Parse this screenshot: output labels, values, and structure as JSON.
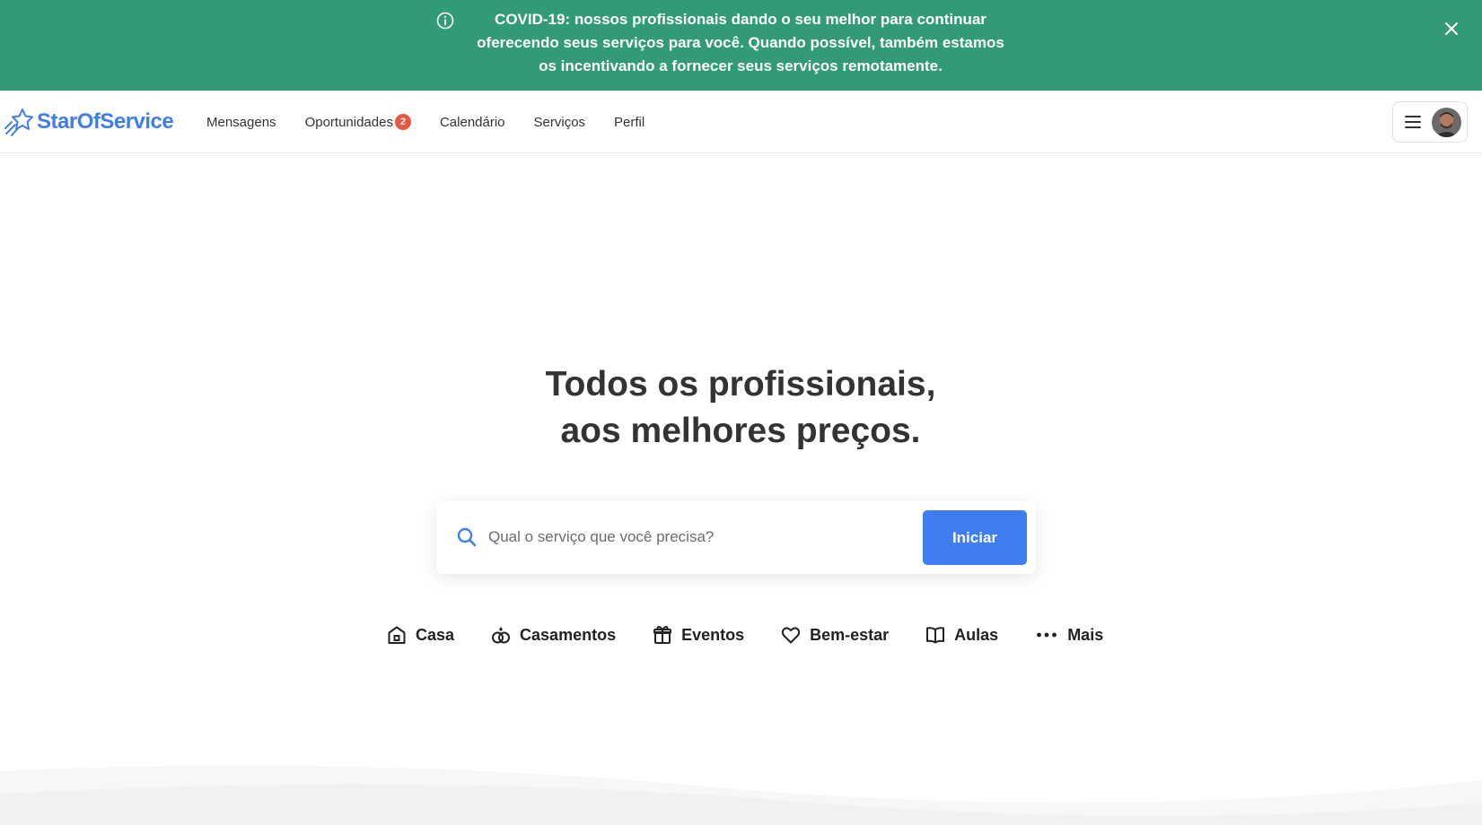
{
  "banner": {
    "text_line": "COVID-19: nossos profissionais dando o seu melhor para continuar oferecendo seus serviços para você. Quando possível, também estamos os incentivando a fornecer seus serviços",
    "emphasis": "remotamente",
    "suffix": ".",
    "info_icon": "info-icon",
    "close_icon": "close-icon",
    "background_color": "#329a74"
  },
  "navbar": {
    "logo_text": "StarOfService",
    "logo_icon": "star-icon",
    "links": [
      {
        "label": "Mensagens"
      },
      {
        "label": "Oportunidades",
        "badge": "2"
      },
      {
        "label": "Calendário"
      },
      {
        "label": "Serviços"
      },
      {
        "label": "Perfil"
      }
    ],
    "menu_icon": "hamburger-icon",
    "brand_color": "#3f7ee8"
  },
  "hero": {
    "title_line1": "Todos os profissionais,",
    "title_line2": "aos melhores preços."
  },
  "search": {
    "placeholder": "Qual o serviço que você precisa?",
    "value": "",
    "button_label": "Iniciar",
    "button_color": "#3f7ef2"
  },
  "categories": [
    {
      "label": "Casa",
      "icon": "house-icon"
    },
    {
      "label": "Casamentos",
      "icon": "rings-icon"
    },
    {
      "label": "Eventos",
      "icon": "gift-icon"
    },
    {
      "label": "Bem-estar",
      "icon": "heart-icon"
    },
    {
      "label": "Aulas",
      "icon": "book-icon"
    },
    {
      "label": "Mais",
      "icon": "more-dots-icon"
    }
  ]
}
